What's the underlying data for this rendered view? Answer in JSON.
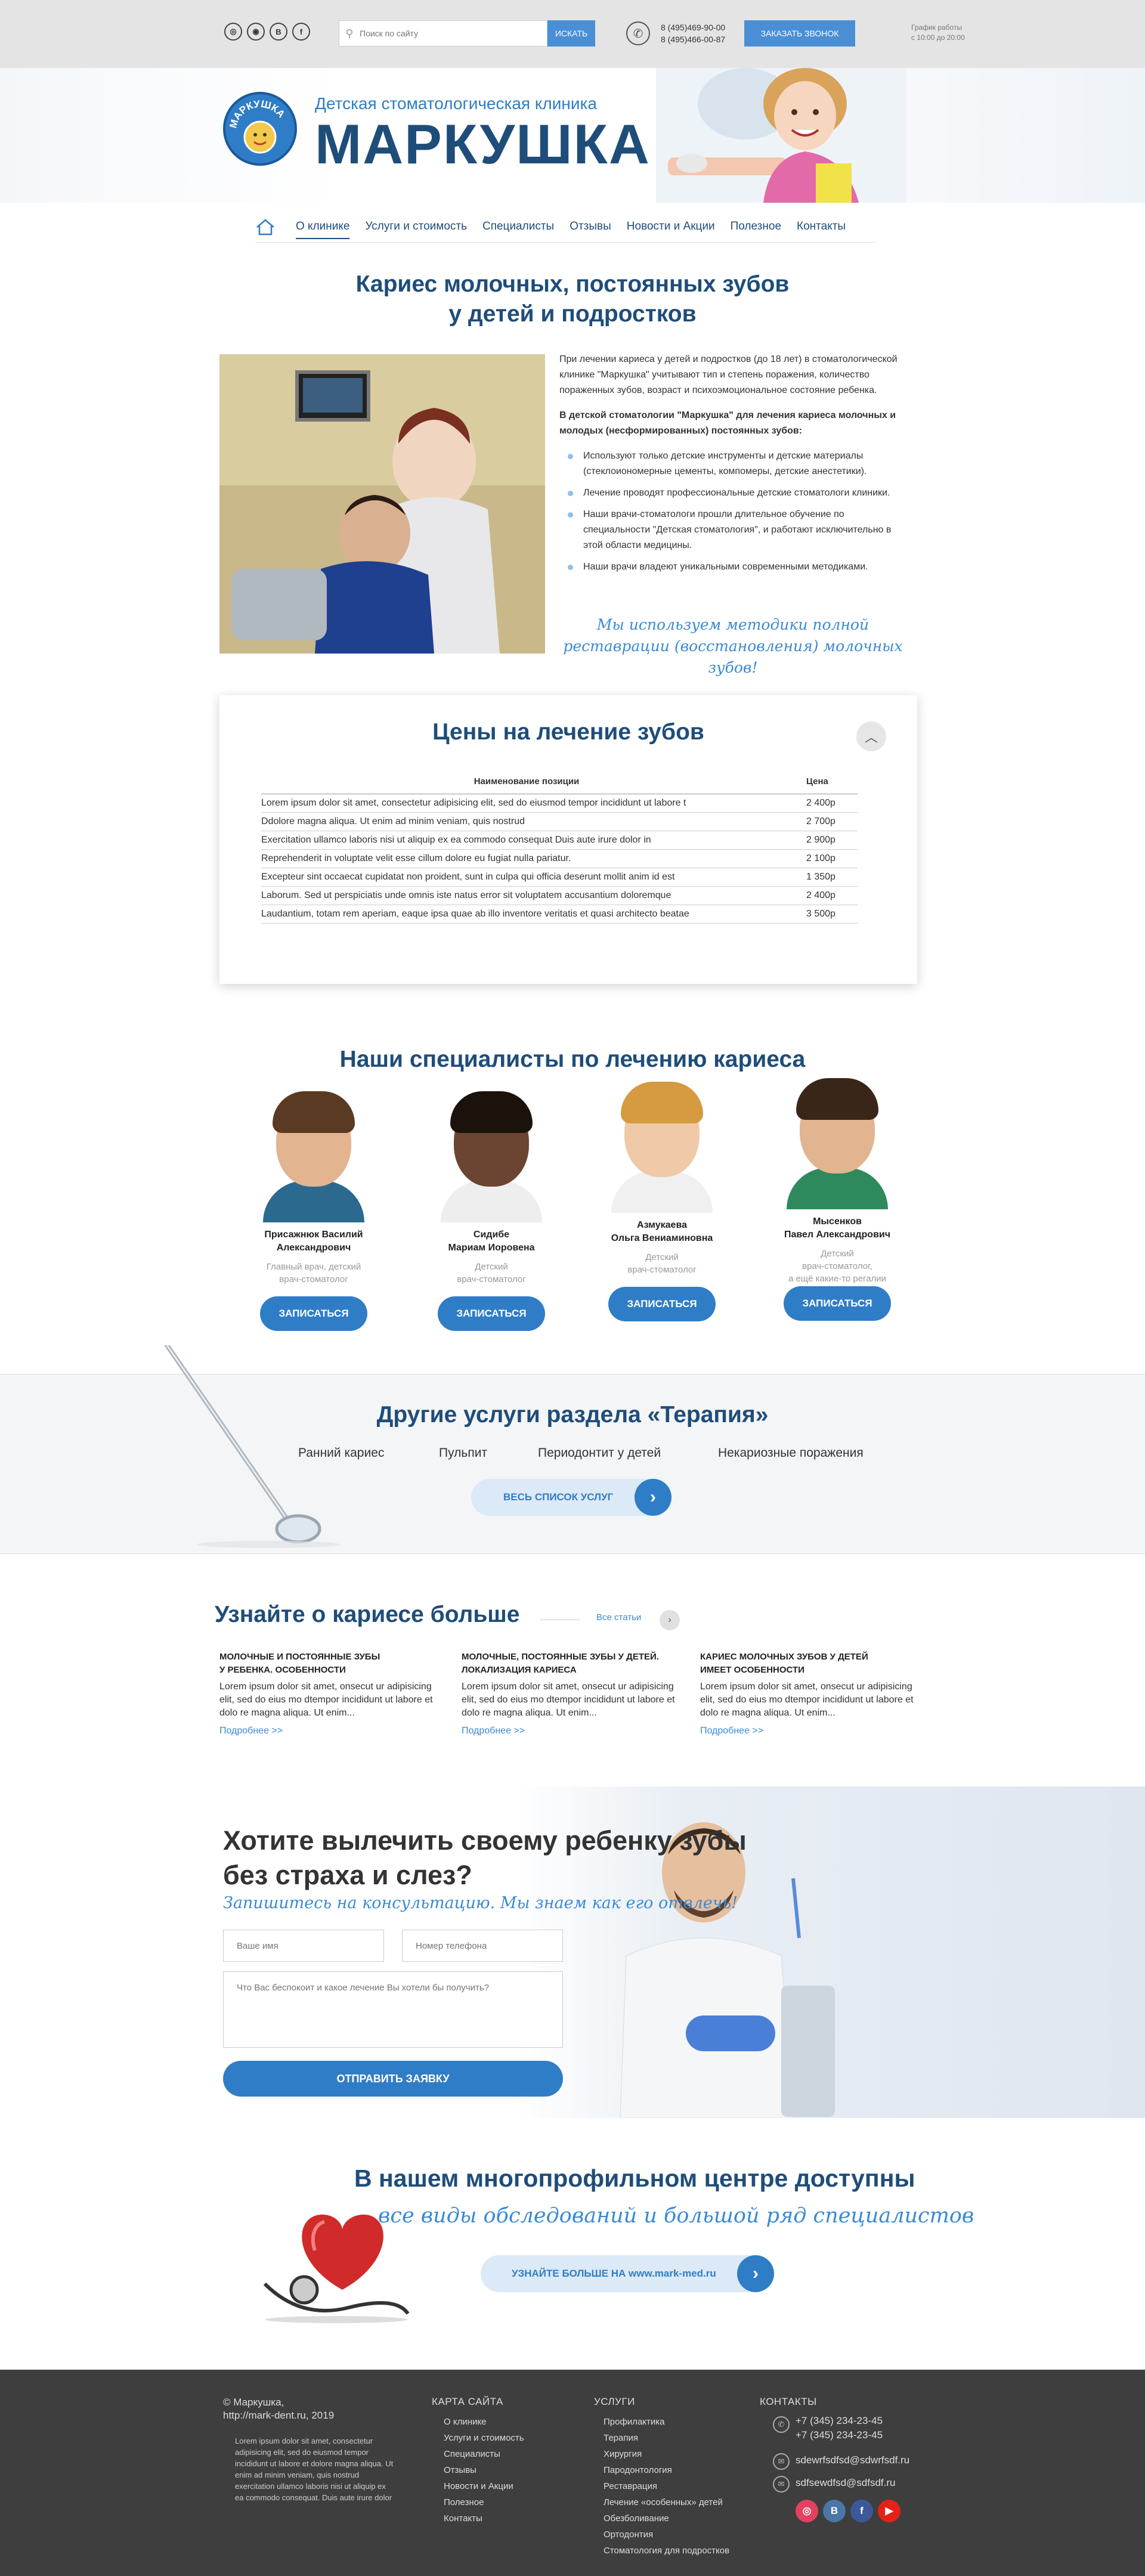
{
  "topbar": {
    "social_icons": [
      "globe-icon",
      "ok-icon",
      "vk-icon",
      "facebook-icon"
    ],
    "social_glyphs": [
      "◎",
      "◉",
      "B",
      "f"
    ],
    "search_placeholder": "Поиск по сайту",
    "search_button": "ИСКАТЬ",
    "phones": [
      "8 (495)469-90-00",
      "8 (495)466-00-87"
    ],
    "call_button": "ЗАКАЗАТЬ ЗВОНОК",
    "hours": [
      "График работы",
      "с 10:00 до 20:00"
    ]
  },
  "header": {
    "subtitle": "Детская стоматологическая клиника",
    "title": "МАРКУШКА",
    "logo_text": "МАРКУШКА"
  },
  "nav": {
    "home_icon": "home-icon",
    "items": [
      "О клинике",
      "Услуги и стоимость",
      "Специалисты",
      "Отзывы",
      "Новости и Акции",
      "Полезное",
      "Контакты"
    ],
    "active": "О клинике"
  },
  "intro": {
    "title_line1": "Кариес молочных, постоянных зубов",
    "title_line2": "у детей и подростков",
    "p1": "При лечении кариеса у детей и подростков (до 18 лет) в стоматологической клинике \"Маркушка\" учитывают тип и степень поражения, количество пораженных зубов, возраст и психоэмоциональное состояние ребенка.",
    "p2": "В детской стоматологии \"Маркушка\" для лечения кариеса молочных и молодых (несформированных) постоянных зубов:",
    "bullets": [
      "Используют только детские инструменты и детские материалы (стеклоиономерные цементы, компомеры, детские анестетики).",
      "Лечение проводят профессиональные детские стоматологи клиники.",
      "Наши врачи-стоматологи прошли длительное обучение по специальности \"Детская стоматология\", и работают исключительно в этой области медицины.",
      "Наши врачи владеют уникальными современными методиками."
    ],
    "script": "Мы используем методики полной реставрации (восстановления) молочных зубов!"
  },
  "prices": {
    "title": "Цены на лечение зубов",
    "col_name": "Наименование позиции",
    "col_price": "Цена",
    "rows": [
      {
        "name": "Lorem ipsum dolor sit amet, consectetur adipisicing elit, sed do eiusmod tempor incididunt ut labore t",
        "price": "2 400р"
      },
      {
        "name": "Ddolore magna aliqua. Ut enim ad minim veniam, quis nostrud",
        "price": "2 700р"
      },
      {
        "name": "Exercitation ullamco laboris nisi ut aliquip ex ea commodo consequat Duis aute irure dolor in",
        "price": "2 900р"
      },
      {
        "name": "Reprehenderit in voluptate velit esse cillum dolore eu fugiat nulla pariatur.",
        "price": "2 100р"
      },
      {
        "name": "Excepteur sint occaecat cupidatat non proident, sunt in culpa qui officia deserunt mollit anim id est",
        "price": "1 350р"
      },
      {
        "name": "Laborum. Sed ut perspiciatis unde omnis iste natus error sit voluptatem accusantium doloremque",
        "price": "2 400р"
      },
      {
        "name": "Laudantium, totam rem aperiam, eaque ipsa quae ab illo inventore veritatis et quasi architecto beatae",
        "price": "3 500р"
      }
    ]
  },
  "specialists": {
    "title": "Наши специалисты по лечению кариеса",
    "button": "ЗАПИСАТЬСЯ",
    "items": [
      {
        "name1": "Присажнюк Василий",
        "name2": "Александрович",
        "role1": "Главный врач, детский",
        "role2": "врач-стоматолог"
      },
      {
        "name1": "Сидибе",
        "name2": "Мариам Иоровена",
        "role1": "Детский",
        "role2": "врач-стоматолог"
      },
      {
        "name1": "Азмукаева",
        "name2": "Ольга Вениаминовна",
        "role1": "Детский",
        "role2": "врач-стоматолог"
      },
      {
        "name1": "Мысенков",
        "name2": "Павел Александрович",
        "role1": "Детский",
        "role2": "врач-стоматолог,"
      }
    ],
    "extra_role": "а ещё какие-то регалии"
  },
  "services": {
    "title": "Другие услуги раздела «Терапия»",
    "items": [
      "Ранний кариес",
      "Пульпит",
      "Периодонтит у детей",
      "Некариозные поражения"
    ],
    "all_button": "ВЕСЬ СПИСОК УСЛУГ"
  },
  "articles": {
    "title": "Узнайте о кариесе больше",
    "all_link": "Все статьи",
    "more": "Подробнее >>",
    "items": [
      {
        "t1": "МОЛОЧНЫЕ И ПОСТОЯННЫЕ ЗУБЫ",
        "t2": "У РЕБЕНКА. ОСОБЕННОСТИ",
        "d": "Lorem ipsum dolor sit amet, onsecut ur adipisicing elit, sed do eius mo dtempor incididunt ut labore et dolo re magna aliqua. Ut enim..."
      },
      {
        "t1": "МОЛОЧНЫЕ, ПОСТОЯННЫЕ ЗУБЫ У ДЕТЕЙ.",
        "t2": "ЛОКАЛИЗАЦИЯ КАРИЕСА",
        "d": "Lorem ipsum dolor sit amet, onsecut ur adipisicing elit, sed do eius mo dtempor incididunt ut labore et dolo re magna aliqua. Ut enim..."
      },
      {
        "t1": "КАРИЕС МОЛОЧНЫХ ЗУБОВ У ДЕТЕЙ",
        "t2": "ИМЕЕТ ОСОБЕННОСТИ",
        "d": "Lorem ipsum dolor sit amet, onsecut ur adipisicing elit, sed do eius mo dtempor incididunt ut labore et dolo re magna aliqua. Ut enim..."
      }
    ]
  },
  "cta": {
    "title_line1": "Хотите вылечить своему ребенку зубы",
    "title_line2": "без страха и слез?",
    "subtitle": "Запишитесь на консультацию. Мы знаем как его отвлечь!",
    "name_placeholder": "Ваше имя",
    "phone_placeholder": "Номер телефона",
    "message_placeholder": "Что Вас беспокоит и какое лечение Вы хотели бы получить?",
    "button": "ОТПРАВИТЬ ЗАЯВКУ"
  },
  "center": {
    "title": "В нашем многопрофильном центре доступны",
    "subtitle": "все виды обследований и большой ряд специалистов",
    "button": "УЗНАЙТЕ БОЛЬШЕ НА www.mark-med.ru"
  },
  "footer": {
    "copy_line1": "© Маркушка,",
    "copy_line2": "http://mark-dent.ru, 2019",
    "lorem": "Lorem ipsum dolor sit amet, consectetur adipisicing elit, sed do eiusmod tempor incididunt ut labore et dolore magna aliqua. Ut enim ad minim veniam, quis nostrud exercitation ullamco laboris nisi ut aliquip ex ea commodo consequat. Duis aute irure dolor",
    "sitemap_title": "КАРТА САЙТА",
    "sitemap": [
      "О клинике",
      "Услуги и стоимость",
      "Специалисты",
      "Отзывы",
      "Новости и Акции",
      "Полезное",
      "Контакты"
    ],
    "services_title": "УСЛУГИ",
    "services": [
      "Профилактика",
      "Терапия",
      "Хирургия",
      "Пародонтология",
      "Реставрация",
      "Лечение «особенных» детей",
      "Обезболивание",
      "Ортодонтия",
      "Стоматология для подростков"
    ],
    "contacts_title": "КОНТАКТЫ",
    "phones": [
      "+7 (345) 234-23-45",
      "+7 (345) 234-23-45"
    ],
    "emails": [
      "sdewrfsdfsd@sdwrfsdf.ru",
      "sdfsewdfsd@sdfsdf.ru"
    ],
    "social": [
      "instagram-icon",
      "vk-icon",
      "facebook-icon",
      "youtube-icon"
    ],
    "social_glyphs": [
      "◎",
      "B",
      "f",
      "▶"
    ],
    "social_colors": [
      "#e4405f",
      "#4a76a8",
      "#3b5998",
      "#e62117"
    ]
  }
}
